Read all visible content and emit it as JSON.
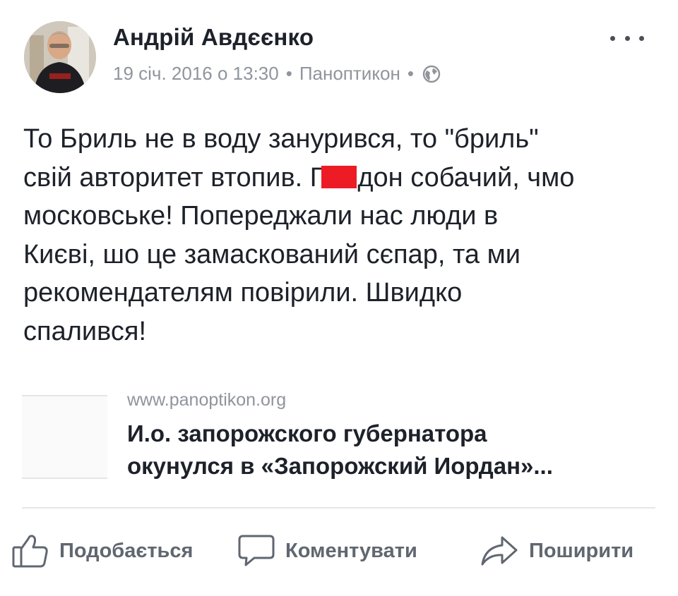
{
  "post": {
    "author": "Андрій Авдєєнко",
    "meta": {
      "date": "19 січ. 2016 о 13:30",
      "separator": "•",
      "page": "Паноптикон",
      "privacy_icon": "globe-icon"
    },
    "text": {
      "line1": "То Бриль не в воду занурився, то \"бриль\"",
      "line2_start": "свій авторитет втопив. Г",
      "line2_end": "дон собачий, чмо",
      "line3": "московське! Попереджали нас люди в",
      "line4": "Києві, шо це замаскований сєпар, та ми",
      "line5": "рекомендателям повірили. Швидко",
      "line6": "спалився!"
    },
    "link_preview": {
      "domain": "www.panoptikon.org",
      "title_line1": "И.о. запорожского губернатора",
      "title_line2": "окунулся в «Запорожский Иордан»..."
    },
    "actions": {
      "like": "Подобається",
      "comment": "Коментувати",
      "share": "Поширити"
    },
    "colors": {
      "text": "#1d2129",
      "secondary": "#90949c",
      "action": "#606770",
      "redaction": "#ed1c24"
    }
  }
}
